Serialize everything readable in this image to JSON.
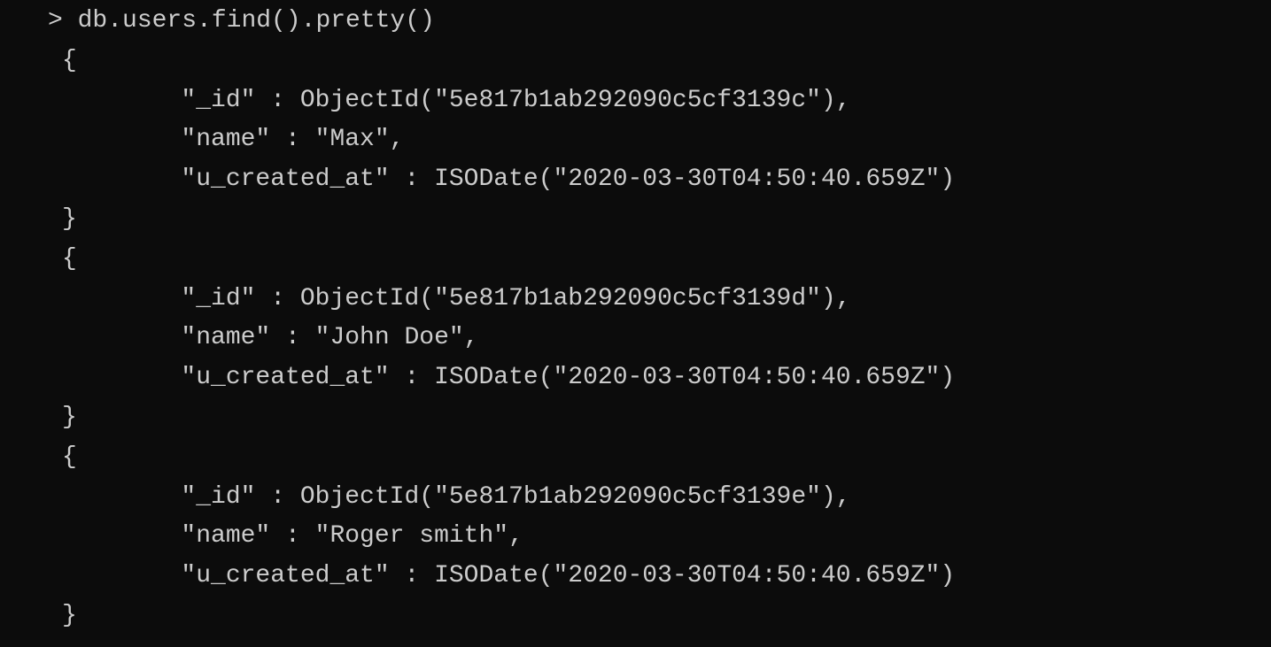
{
  "prompt": "> ",
  "command": "db.users.find().pretty()",
  "records": [
    {
      "open": "{",
      "id_line": "        \"_id\" : ObjectId(\"5e817b1ab292090c5cf3139c\"),",
      "name_line": "        \"name\" : \"Max\",",
      "created_line": "        \"u_created_at\" : ISODate(\"2020-03-30T04:50:40.659Z\")",
      "close": "}"
    },
    {
      "open": "{",
      "id_line": "        \"_id\" : ObjectId(\"5e817b1ab292090c5cf3139d\"),",
      "name_line": "        \"name\" : \"John Doe\",",
      "created_line": "        \"u_created_at\" : ISODate(\"2020-03-30T04:50:40.659Z\")",
      "close": "}"
    },
    {
      "open": "{",
      "id_line": "        \"_id\" : ObjectId(\"5e817b1ab292090c5cf3139e\"),",
      "name_line": "        \"name\" : \"Roger smith\",",
      "created_line": "        \"u_created_at\" : ISODate(\"2020-03-30T04:50:40.659Z\")",
      "close": "}"
    }
  ]
}
